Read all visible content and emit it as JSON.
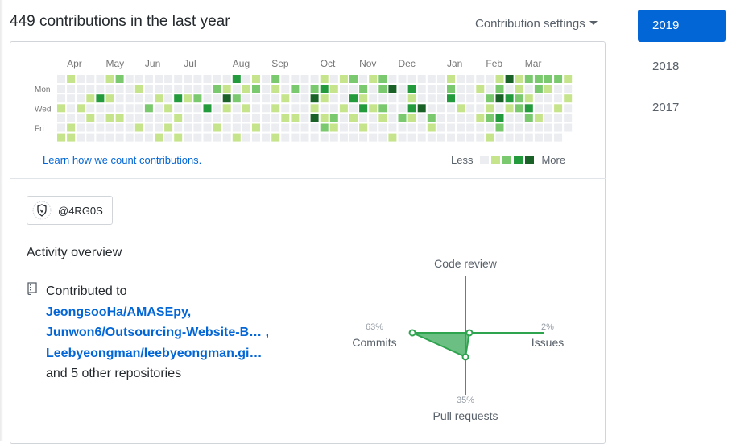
{
  "header": {
    "title": "449 contributions in the last year",
    "settings_label": "Contribution settings"
  },
  "calendar": {
    "months": [
      "Apr",
      "May",
      "Jun",
      "Jul",
      "Aug",
      "Sep",
      "Oct",
      "Nov",
      "Dec",
      "Jan",
      "Feb",
      "Mar"
    ],
    "month_weeks": [
      1,
      5,
      9,
      13,
      18,
      22,
      27,
      31,
      35,
      40,
      44,
      48
    ],
    "day_labels": [
      "Mon",
      "Wed",
      "Fri"
    ],
    "weeks": 53,
    "levels": {
      "1": [
        "0,3",
        "0,6",
        "1,0",
        "1,5",
        "1,6",
        "2,3",
        "3,2",
        "3,4",
        "5,0",
        "5,2",
        "5,4",
        "6,4",
        "8,1",
        "8,5",
        "10,2",
        "10,6",
        "11,3",
        "11,5",
        "12,4",
        "12,6",
        "13,2",
        "16,5",
        "17,1",
        "17,3",
        "18,6",
        "19,1",
        "19,3",
        "20,0",
        "20,5",
        "22,1",
        "22,3",
        "22,6",
        "23,2",
        "23,4",
        "24,4",
        "26,3",
        "27,0",
        "27,2",
        "27,4",
        "28,1",
        "28,5",
        "29,0",
        "29,3",
        "30,4",
        "31,2",
        "31,5",
        "32,0",
        "32,3",
        "33,4",
        "34,1",
        "34,6",
        "36,2",
        "36,4",
        "38,5",
        "40,0",
        "40,2",
        "41,3",
        "43,1",
        "43,4",
        "44,3",
        "44,6",
        "45,0",
        "46,3",
        "47,0",
        "47,1",
        "48,2",
        "49,4",
        "50,1",
        "51,3",
        "52,0",
        "52,2"
      ],
      "2": [
        "6,0",
        "9,3",
        "14,2",
        "16,1",
        "18,2",
        "20,1",
        "22,0",
        "24,1",
        "26,1",
        "27,5",
        "28,4",
        "30,0",
        "31,1",
        "33,0",
        "33,1",
        "33,3",
        "35,4",
        "38,4",
        "40,1",
        "44,2",
        "44,4",
        "45,1",
        "45,5",
        "46,0",
        "47,2",
        "47,3",
        "48,0",
        "48,4",
        "49,0",
        "49,1",
        "50,0",
        "51,0"
      ],
      "3": [
        "4,2",
        "12,2",
        "15,3",
        "18,0",
        "27,1",
        "30,2",
        "31,3",
        "36,1",
        "36,3",
        "40,2",
        "45,4",
        "46,2",
        "48,3"
      ],
      "4": [
        "17,2",
        "26,2",
        "26,4",
        "34,1",
        "37,3",
        "45,2",
        "46,0"
      ]
    },
    "learn_link": "Learn how we count contributions.",
    "legend_less": "Less",
    "legend_more": "More",
    "colors": [
      "#ebedf0",
      "#c6e48b",
      "#7bc96f",
      "#239a3b",
      "#196127"
    ]
  },
  "org": {
    "name": "@4RG0S"
  },
  "activity": {
    "title": "Activity overview",
    "contributed_to": "Contributed to",
    "repos": [
      "JeongsooHa/AMASEpy,",
      "Junwon6/Outsourcing-Website-B… ,",
      "Leebyeongman/leebyeongman.gi…"
    ],
    "others": "and 5 other repositories"
  },
  "radar": {
    "code_review": {
      "label": "Code review",
      "pct": ""
    },
    "commits": {
      "label": "Commits",
      "pct": "63%",
      "value": 63
    },
    "issues": {
      "label": "Issues",
      "pct": "2%",
      "value": 2
    },
    "pull_requests": {
      "label": "Pull requests",
      "pct": "35%",
      "value": 35
    },
    "color": "#2ea44f"
  },
  "years": [
    "2019",
    "2018",
    "2017"
  ]
}
